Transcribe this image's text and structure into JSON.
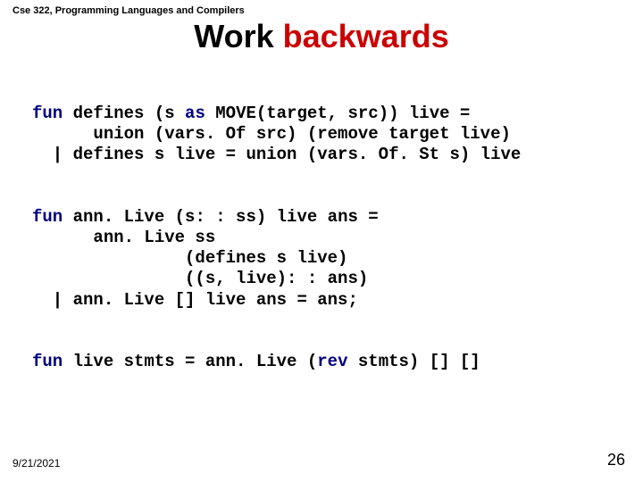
{
  "course_header": "Cse 322, Programming Languages and Compilers",
  "title": {
    "word1": "Work",
    "word2": "backwards"
  },
  "kw": {
    "fun": "fun",
    "as": "as",
    "rev": "rev"
  },
  "code": {
    "l1a": " defines (s ",
    "l1b": " MOVE(target, src)) live =",
    "l2": "      union (vars. Of src) (remove target live)",
    "l3": "  | defines s live = union (vars. Of. St s) live",
    "l4": " ann. Live (s: : ss) live ans =",
    "l5": "      ann. Live ss",
    "l6": "               (defines s live)",
    "l7": "               ((s, live): : ans)",
    "l8": "  | ann. Live [] live ans = ans;",
    "l9a": " live stmts = ann. Live (",
    "l9b": " stmts) [] []"
  },
  "footer": {
    "date": "9/21/2021",
    "page": "26"
  }
}
